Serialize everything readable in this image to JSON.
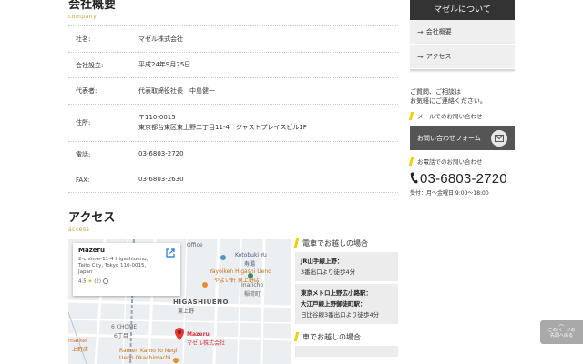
{
  "company": {
    "title": "会社概要",
    "subtitle": "company",
    "rows": [
      {
        "label": "社名:",
        "value": "マゼル株式会社"
      },
      {
        "label": "会社設立:",
        "value": "平成24年9月25日"
      },
      {
        "label": "代表者:",
        "value": "代表取締役社長　中島健一"
      },
      {
        "label": "住所:",
        "value_line1": "〒110-0015",
        "value_line2": "東京都台東区東上野二丁目11-4　ジャストプレイスビル1F"
      },
      {
        "label": "電話:",
        "value": "03-6803-2720"
      },
      {
        "label": "FAX:",
        "value": "03-6803-2630"
      }
    ]
  },
  "access": {
    "title": "アクセス",
    "subtitle": "access"
  },
  "map": {
    "card_name": "Mazeru",
    "card_addr_1": "2-chōme-11-4 Higashiueno,",
    "card_addr_2": "Taito City, Tokyo 110-0015,",
    "card_addr_3": "Japan",
    "card_rating": "4.5",
    "card_reviews": "(2)",
    "labels": {
      "office": "Office",
      "kotobuki": "Kotobuki Yu",
      "kotobuki_jp": "寿湯",
      "yayoiken": "Yayoiken Higashi Ueno",
      "yayoiken_jp": "やよい軒 東上野店",
      "inaricho": "Inaricho",
      "inaricho_jp": "稲荷町",
      "higashiueno": "HIGASHIUENO",
      "higashiueno_jp": "東上野",
      "chome": "6 CHOME",
      "chome_jp": "6丁目",
      "market": "market",
      "market_jp": "上野店",
      "pin": "Mazeru",
      "pin_jp": "マゼル株式会社",
      "ramen": "Ramen Kamo to Negi",
      "ramen_2": "Ueno Okachimachi"
    }
  },
  "directions": {
    "train_head": "電車でお越しの場合",
    "jr_title": "JR山手線上野：",
    "jr_exit": "3番出口より徒歩4分",
    "metro_title_1": "東京メトロ上野広小路駅：",
    "metro_title_2": "大江戸線上野御徒町駅：",
    "metro_line": "日比谷線3番出口より",
    "metro_walk": "徒歩4分",
    "car_head": "車でお越しの場合"
  },
  "sidebar": {
    "header": "マゼルについて",
    "links": [
      "会社概要",
      "アクセス"
    ],
    "msg_1": "ご質問、ご相談は",
    "msg_2": "お気軽にご連絡ください。",
    "mail_sub": "メールでのお問い合わせ",
    "mail_btn": "お問い合わせフォーム",
    "tel_sub": "お電話でのお問い合わせ",
    "tel": "03-6803-2720",
    "hours": "受付：月～金曜日 9:00～18:00"
  },
  "to_top": {
    "line1": "このページの",
    "line2": "先頭へ戻る"
  },
  "colors": {
    "accent_yellow": "#f0d000",
    "subtitle_gold": "#c9a33a",
    "sidebar_dark": "#333333"
  }
}
